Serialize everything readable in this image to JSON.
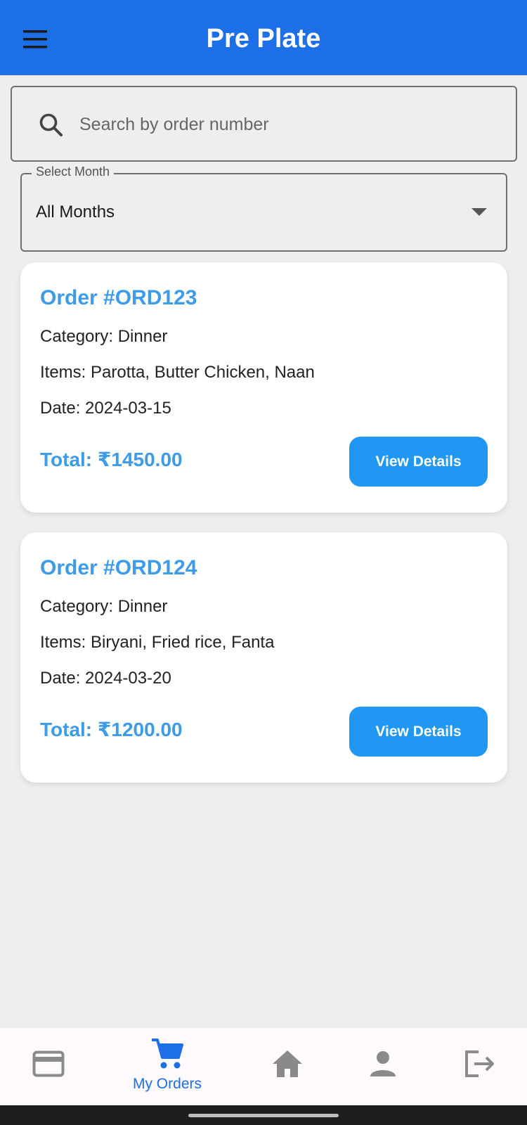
{
  "app": {
    "title": "Pre Plate"
  },
  "search": {
    "placeholder": "Search by order number",
    "value": ""
  },
  "month_filter": {
    "label": "Select Month",
    "selected": "All Months"
  },
  "orders": [
    {
      "title": "Order #ORD123",
      "category": "Category: Dinner",
      "items": "Items: Parotta, Butter Chicken, Naan",
      "date": "Date: 2024-03-15",
      "total": "Total: ₹1450.00",
      "button": "View Details"
    },
    {
      "title": "Order #ORD124",
      "category": "Category: Dinner",
      "items": "Items: Biryani, Fried rice, Fanta",
      "date": "Date: 2024-03-20",
      "total": "Total: ₹1200.00",
      "button": "View Details"
    }
  ],
  "bottom_nav": {
    "items": [
      {
        "icon": "credit-card-icon",
        "label": ""
      },
      {
        "icon": "shopping-cart-icon",
        "label": "My Orders",
        "active": true
      },
      {
        "icon": "home-icon",
        "label": ""
      },
      {
        "icon": "person-icon",
        "label": ""
      },
      {
        "icon": "logout-icon",
        "label": ""
      }
    ]
  },
  "colors": {
    "app_bar": "#1d6fe8",
    "accent_text": "#3d9be9",
    "button": "#2196f3",
    "nav_active": "#1d6fe8",
    "nav_inactive": "#8a8a8a",
    "background": "#eeeeee"
  }
}
